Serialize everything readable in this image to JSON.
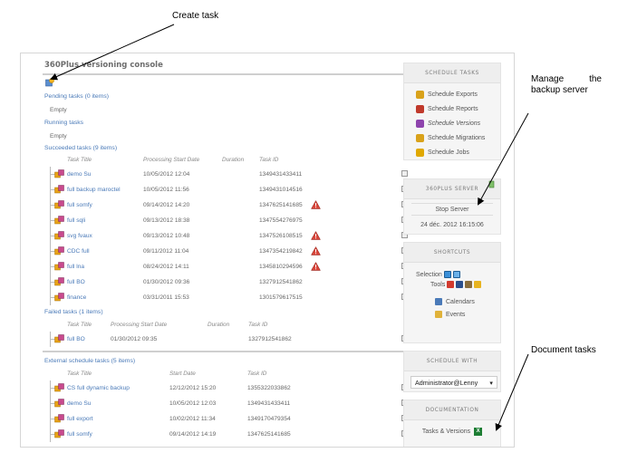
{
  "annotations": {
    "create_task": "Create task",
    "manage_line1_a": "Manage",
    "manage_line1_b": "the",
    "manage_line2": "backup server",
    "document_tasks": "Document tasks"
  },
  "console": {
    "title": "360Plus versioning console",
    "pending": {
      "label": "Pending tasks (0 items)",
      "empty": "Empty"
    },
    "running": {
      "label": "Running tasks",
      "empty": "Empty"
    },
    "succeeded": {
      "label": "Succeeded tasks (9 items)",
      "headers": {
        "title": "Task Title",
        "start": "Processing Start Date",
        "duration": "Duration",
        "id": "Task ID"
      },
      "rows": [
        {
          "name": "demo Su",
          "date": "10/05/2012 12:04",
          "id": "1349431433411",
          "warn": false
        },
        {
          "name": "full backup maroctel",
          "date": "10/05/2012 11:56",
          "id": "1349431014516",
          "warn": false
        },
        {
          "name": "full somfy",
          "date": "09/14/2012 14:20",
          "id": "1347625141685",
          "warn": true
        },
        {
          "name": "full sqli",
          "date": "09/13/2012 18:38",
          "id": "1347554276975",
          "warn": false
        },
        {
          "name": "svg fvaux",
          "date": "09/13/2012 10:48",
          "id": "1347526108515",
          "warn": true
        },
        {
          "name": "CDC full",
          "date": "09/11/2012 11:04",
          "id": "1347354219842",
          "warn": true
        },
        {
          "name": "full lna",
          "date": "08/24/2012 14:11",
          "id": "1345810294596",
          "warn": true
        },
        {
          "name": "full BO",
          "date": "01/30/2012 09:36",
          "id": "1327912541862",
          "warn": false
        },
        {
          "name": "finance",
          "date": "03/31/2011 15:53",
          "id": "1301579617515",
          "warn": false
        }
      ]
    },
    "failed": {
      "label": "Failed tasks (1 items)",
      "headers": {
        "title": "Task Title",
        "start": "Processing Start Date",
        "duration": "Duration",
        "id": "Task ID"
      },
      "rows": [
        {
          "name": "full BO",
          "date": "01/30/2012 09:35",
          "id": "1327912541862"
        }
      ]
    },
    "external": {
      "label": "External schedule tasks (5 items)",
      "headers": {
        "title": "Task Title",
        "start": "Start Date",
        "id": "Task ID"
      },
      "rows": [
        {
          "name": "CS full dynamic backup",
          "date": "12/12/2012 15:20",
          "id": "1355322033862"
        },
        {
          "name": "demo Su",
          "date": "10/05/2012 12:03",
          "id": "1349431433411"
        },
        {
          "name": "full export",
          "date": "10/02/2012 11:34",
          "id": "1349170479354"
        },
        {
          "name": "full somfy",
          "date": "09/14/2012 14:19",
          "id": "1347625141685"
        }
      ]
    }
  },
  "sidebar": {
    "schedule_tasks": {
      "header": "SCHEDULE TASKS",
      "items": [
        {
          "label": "Schedule Exports",
          "icon": "export-icon",
          "color": "#d9a21b"
        },
        {
          "label": "Schedule Reports",
          "icon": "report-icon",
          "color": "#c0392b"
        },
        {
          "label": "Schedule Versions",
          "icon": "versions-icon",
          "color": "#8e44ad"
        },
        {
          "label": "Schedule Migrations",
          "icon": "migration-icon",
          "color": "#d9a21b"
        },
        {
          "label": "Schedule Jobs",
          "icon": "jobs-icon",
          "color": "#e0a800"
        }
      ]
    },
    "server": {
      "header": "360PLUS SERVER",
      "stop_label": "Stop Server",
      "datetime": "24 déc. 2012 16:15:06"
    },
    "shortcuts": {
      "header": "SHORTCUTS",
      "selection_label": "Selection",
      "tools_label": "Tools",
      "calendars_label": "Calendars",
      "events_label": "Events"
    },
    "schedule_with": {
      "header": "SCHEDULE WITH",
      "selected": "Administrator@Lenny"
    },
    "documentation": {
      "header": "DOCUMENTATION",
      "link_label": "Tasks & Versions"
    }
  },
  "colors": {
    "link": "#4a7ab8",
    "warning": "#c0392b",
    "excel": "#1e7e34"
  }
}
